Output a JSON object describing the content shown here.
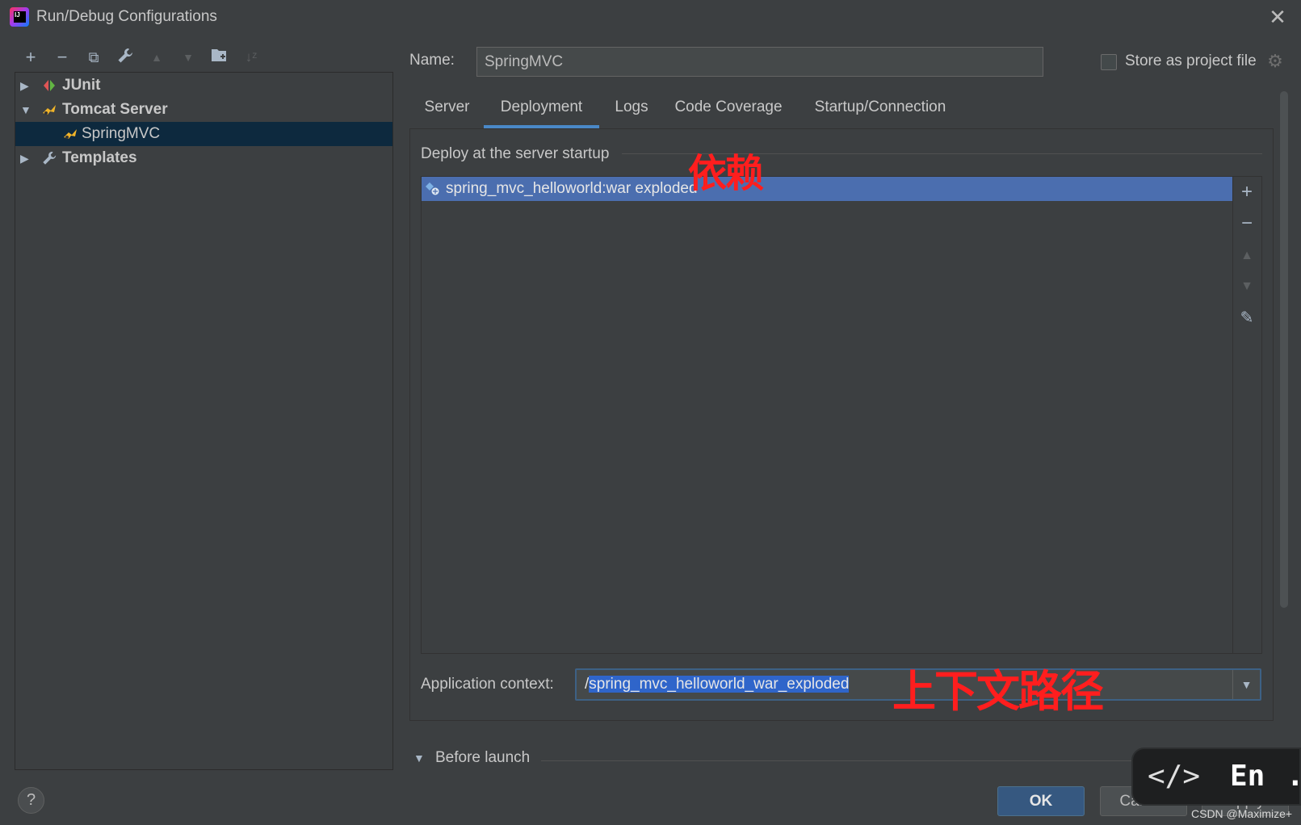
{
  "window": {
    "title": "Run/Debug Configurations",
    "close_icon": "close-icon"
  },
  "toolbar": {
    "add": "+",
    "remove": "−",
    "copy": "⧉",
    "edit": "🔧",
    "up": "▲",
    "down": "▼",
    "folder": "▣",
    "sort": "↓ᶻ"
  },
  "tree": {
    "items": [
      {
        "label": "JUnit",
        "expanded": false,
        "icon": "junit-icon"
      },
      {
        "label": "Tomcat Server",
        "expanded": true,
        "icon": "tomcat-icon"
      },
      {
        "label": "SpringMVC",
        "selected": true,
        "icon": "tomcat-icon"
      },
      {
        "label": "Templates",
        "expanded": false,
        "icon": "wrench-icon"
      }
    ]
  },
  "name_field": {
    "label": "Name:",
    "value": "SpringMVC"
  },
  "store": {
    "label": "Store as project file",
    "checked": false
  },
  "tabs": [
    {
      "label": "Server"
    },
    {
      "label": "Deployment",
      "active": true
    },
    {
      "label": "Logs"
    },
    {
      "label": "Code Coverage"
    },
    {
      "label": "Startup/Connection"
    }
  ],
  "deployment": {
    "section_title": "Deploy at the server startup",
    "items": [
      {
        "label": "spring_mvc_helloworld:war exploded",
        "selected": true
      }
    ],
    "side_buttons": [
      "+",
      "−",
      "▲",
      "▼",
      "✎"
    ]
  },
  "annotations": {
    "dependency": "依赖",
    "context_path": "上下文路径"
  },
  "context": {
    "label": "Application context:",
    "prefix": "/",
    "value": "spring_mvc_helloworld_war_exploded"
  },
  "before_launch": {
    "label": "Before launch"
  },
  "buttons": {
    "help": "?",
    "ok": "OK",
    "cancel": "Cancel",
    "apply": "Apply"
  },
  "overlay": {
    "code": "</>",
    "lang": "En",
    "dot": "."
  },
  "watermark": "CSDN @Maximize+",
  "colors": {
    "background": "#3c3f41",
    "selection": "#4b6eaf",
    "tree_selection": "#0d293e",
    "tab_underline": "#4a88c7",
    "annotation": "#ff1e1e",
    "ok_button": "#365880"
  }
}
